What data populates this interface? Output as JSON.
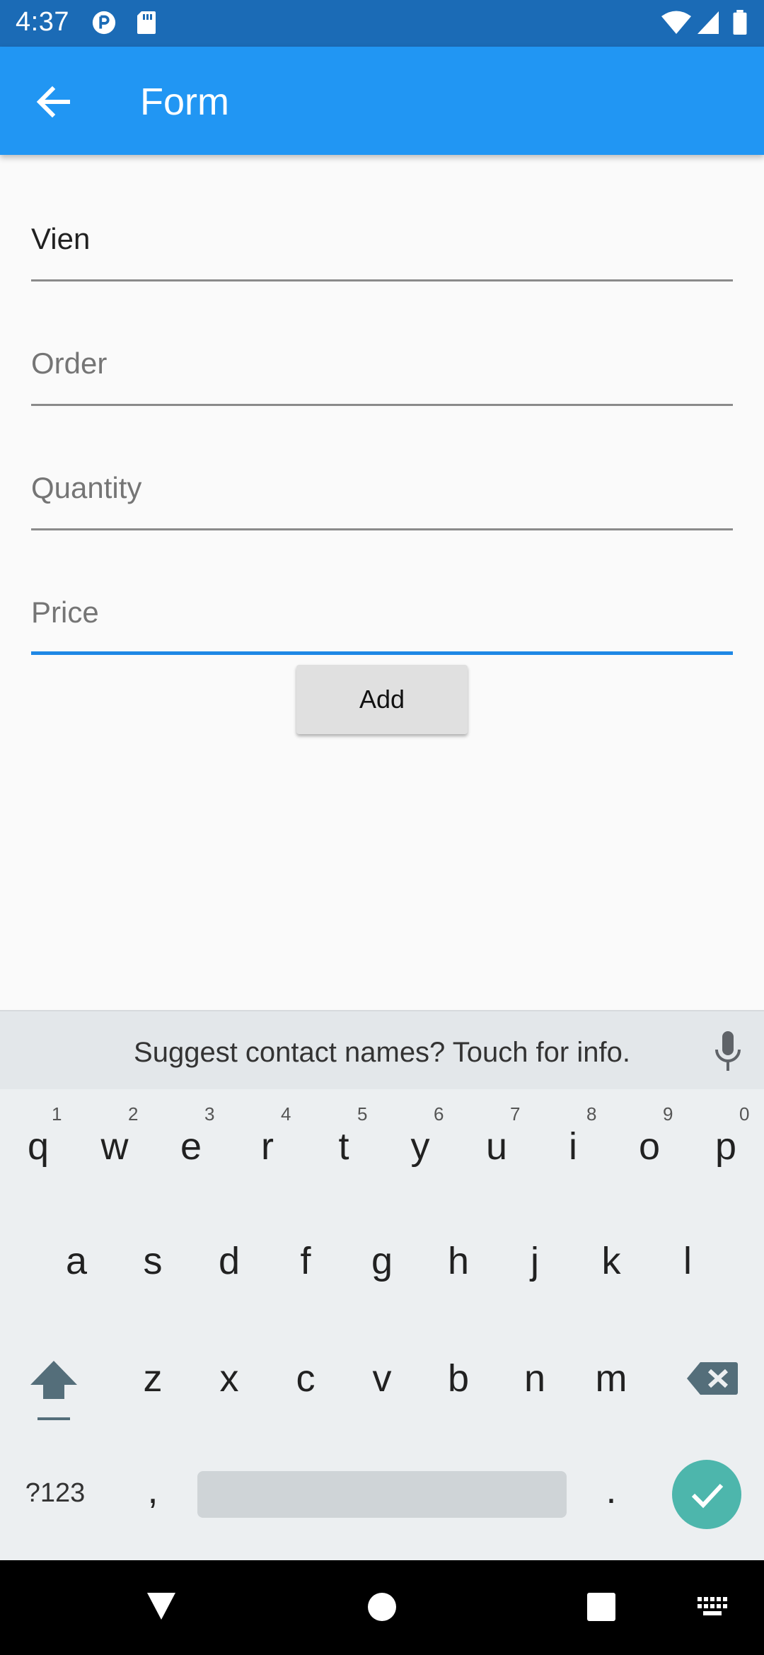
{
  "status_bar": {
    "time": "4:37",
    "icons": [
      "p-app-icon",
      "sd-card-icon",
      "wifi-icon",
      "signal-icon",
      "battery-icon"
    ]
  },
  "app_bar": {
    "title": "Form",
    "back_icon": "arrow-back-icon",
    "color": "#2196f3"
  },
  "form": {
    "name": {
      "value": "Vien"
    },
    "order": {
      "placeholder": "Order"
    },
    "quantity": {
      "placeholder": "Quantity"
    },
    "price": {
      "placeholder": "Price"
    },
    "add_label": "Add",
    "focus_color": "#1e88e5"
  },
  "keyboard": {
    "suggestion": "Suggest contact names? Touch for info.",
    "row1": [
      {
        "k": "q",
        "n": "1"
      },
      {
        "k": "w",
        "n": "2"
      },
      {
        "k": "e",
        "n": "3"
      },
      {
        "k": "r",
        "n": "4"
      },
      {
        "k": "t",
        "n": "5"
      },
      {
        "k": "y",
        "n": "6"
      },
      {
        "k": "u",
        "n": "7"
      },
      {
        "k": "i",
        "n": "8"
      },
      {
        "k": "o",
        "n": "9"
      },
      {
        "k": "p",
        "n": "0"
      }
    ],
    "row2": [
      "a",
      "s",
      "d",
      "f",
      "g",
      "h",
      "j",
      "k",
      "l"
    ],
    "row3": [
      "z",
      "x",
      "c",
      "v",
      "b",
      "n",
      "m"
    ],
    "symbols_label": "?123",
    "comma": ",",
    "period": ".",
    "enter_color": "#4db6ac"
  },
  "nav_bar": {
    "icons": [
      "back-triangle-icon",
      "home-circle-icon",
      "recents-square-icon",
      "keyboard-switch-icon"
    ]
  }
}
